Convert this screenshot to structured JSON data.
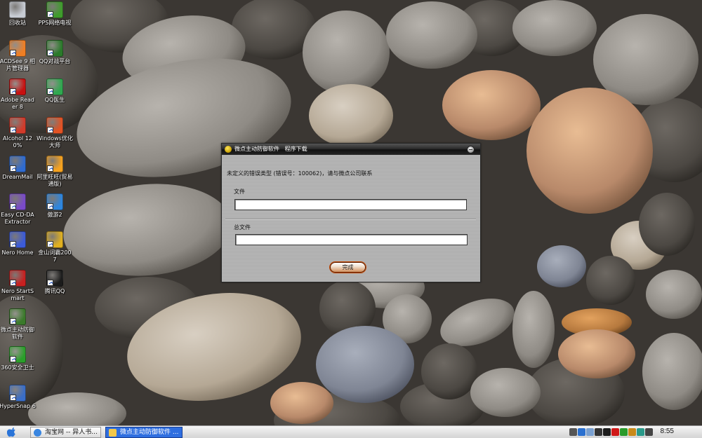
{
  "desktop_icons": [
    {
      "label": "回收站",
      "icon": "recycle-bin-icon",
      "color": "#c8ccd4"
    },
    {
      "label": "PPS网络电视",
      "icon": "pps-icon",
      "color": "#3f9c2c"
    },
    {
      "label": "ACDSee 9 相片管理器",
      "icon": "acdsee-icon",
      "color": "#f07f24"
    },
    {
      "label": "QQ对战平台",
      "icon": "qq-battle-icon",
      "color": "#2a7a2a"
    },
    {
      "label": "Adobe Reader 8",
      "icon": "adobe-reader-icon",
      "color": "#c81010"
    },
    {
      "label": "QQ医生",
      "icon": "qq-doctor-icon",
      "color": "#2fa84f"
    },
    {
      "label": "Alcohol 120%",
      "icon": "alcohol-icon",
      "color": "#d23a2a"
    },
    {
      "label": "Windows优化大师",
      "icon": "windows-optimizer-icon",
      "color": "#e35224"
    },
    {
      "label": "DreamMail",
      "icon": "dreammail-icon",
      "color": "#2f6bd0"
    },
    {
      "label": "阿里旺旺(贸易通版)",
      "icon": "aliwangwang-icon",
      "color": "#f6a21f"
    },
    {
      "label": "Easy CD-DA Extractor",
      "icon": "easy-cd-da-icon",
      "color": "#7a4ac8"
    },
    {
      "label": "傲游2",
      "icon": "maxthon-icon",
      "color": "#2e86de"
    },
    {
      "label": "Nero Home",
      "icon": "nero-home-icon",
      "color": "#3c5bd8"
    },
    {
      "label": "金山词霸2007",
      "icon": "kingsoft-dict-icon",
      "color": "#e0b020"
    },
    {
      "label": "Nero StartSmart",
      "icon": "nero-startsmart-icon",
      "color": "#c82020"
    },
    {
      "label": "腾讯QQ",
      "icon": "qq-icon",
      "color": "#1b1b1b"
    },
    {
      "label": "微点主动防御软件",
      "icon": "micropoint-icon",
      "color": "#3a7a2a"
    },
    {
      "label": "360安全卫士",
      "icon": "360-icon",
      "color": "#2aa02a"
    },
    {
      "label": "HyperSnap 6",
      "icon": "hypersnap-icon",
      "color": "#3a6ec8"
    }
  ],
  "dialog": {
    "title": "微点主动防御软件   程序下载",
    "error_message": "未定义的错误类型 (错误号：100062)，请与微点公司联系",
    "file_label": "文件",
    "total_file_label": "总文件",
    "done_button": "完成"
  },
  "taskbar": {
    "tasks": [
      {
        "label": "淘宝网 -- 异人书...",
        "icon": "ie-icon",
        "active": false
      },
      {
        "label": "微点主动防御软件 ...",
        "icon": "micropoint-icon",
        "active": true
      }
    ],
    "clock": "8:55",
    "tray_icons": [
      "printer-icon",
      "help-icon",
      "signal-icon",
      "volume-icon",
      "qq-tray-icon",
      "kaspersky-icon",
      "shield-tray-icon",
      "network-icon",
      "globe-icon",
      "lock-icon"
    ]
  },
  "colors": {
    "dialog_title_bg": "#1e1e1e",
    "dialog_body": "#b3b3b3",
    "done_button_border": "#c64b07",
    "active_task": "#2e6ee0"
  }
}
